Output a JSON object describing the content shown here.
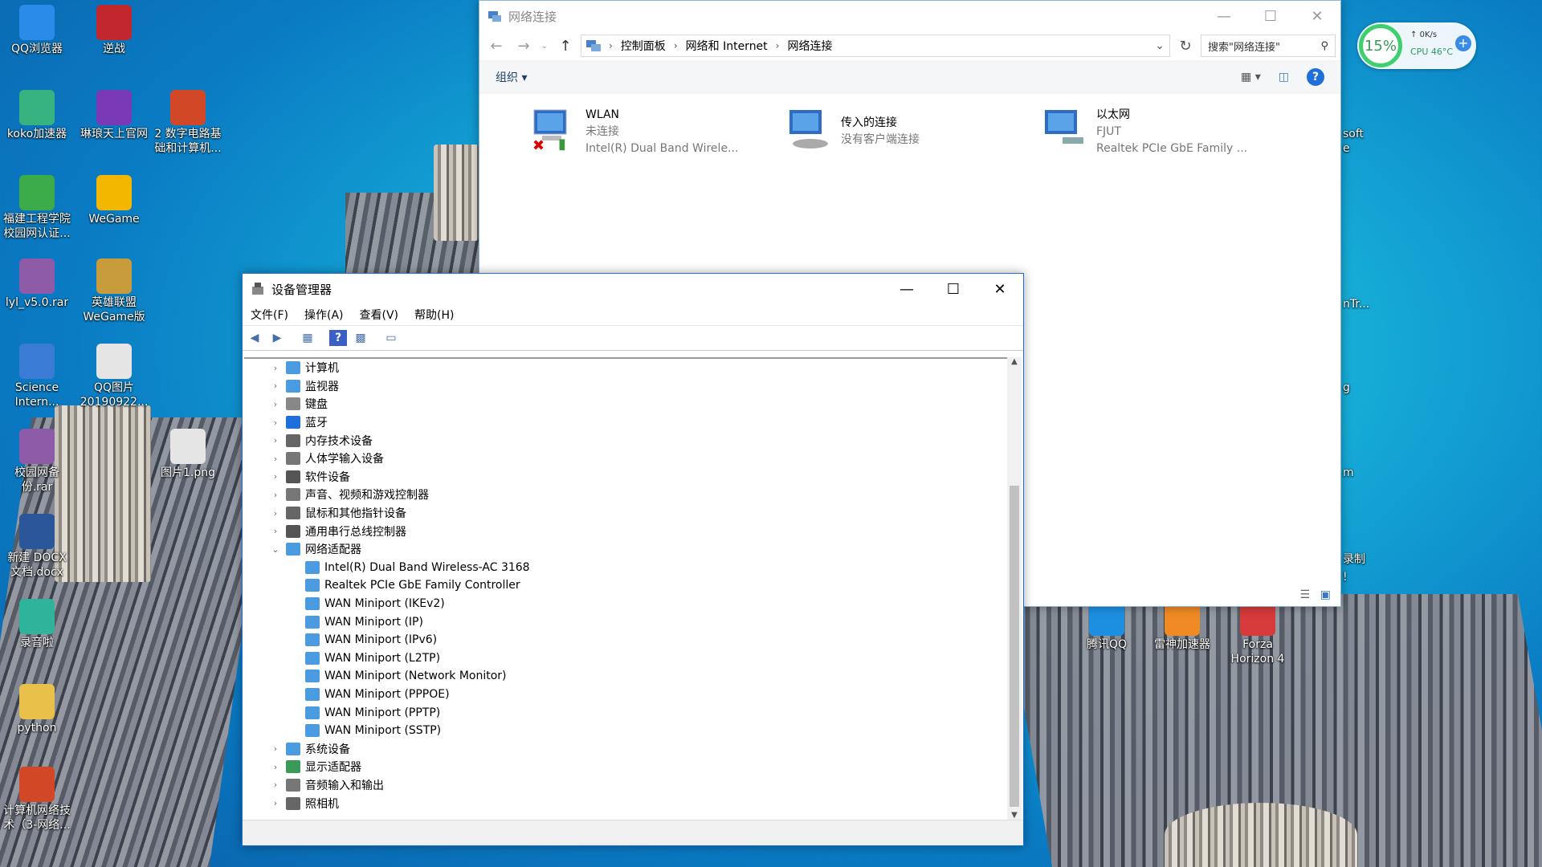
{
  "desktop": {
    "icons_left": [
      {
        "label": "QQ浏览器",
        "color": "#2a8be8"
      },
      {
        "label": "koko加速器",
        "color": "#36b37e"
      },
      {
        "label": "福建工程学院校园网认证...",
        "color": "#3cab4a"
      },
      {
        "label": "lyl_v5.0.rar",
        "color": "#8d5ba8"
      },
      {
        "label": "Science Intern...",
        "color": "#3a7bd5"
      },
      {
        "label": "校园网备份.rar",
        "color": "#8d5ba8"
      },
      {
        "label": "新建 DOCX 文档.docx",
        "color": "#2b579a"
      },
      {
        "label": "录音啦",
        "color": "#2fb39a"
      },
      {
        "label": "python",
        "color": "#e8c04a"
      },
      {
        "label": "计算机网络技术（3-网络...",
        "color": "#d24726"
      }
    ],
    "icons_col2": [
      {
        "label": "逆战",
        "color": "#c0282d"
      },
      {
        "label": "琳琅天上官网",
        "color": "#7a3ab8"
      },
      {
        "label": "WeGame",
        "color": "#f3b700"
      },
      {
        "label": "英雄联盟WeGame版",
        "color": "#c89b3c"
      },
      {
        "label": "QQ图片20190922...",
        "color": "#e5e5e5"
      }
    ],
    "icons_col3": [
      {
        "label": "2 数字电路基础和计算机...",
        "color": "#d24726"
      },
      {
        "label": "图片1.png",
        "color": "#e5e5e5"
      }
    ],
    "icons_bottom": [
      {
        "label": "腾讯QQ",
        "color": "#1d8fe1"
      },
      {
        "label": "雷神加速器",
        "color": "#f08a24"
      },
      {
        "label": "Forza Horizon 4",
        "color": "#d63a3a"
      }
    ],
    "right_partial": [
      "soft",
      "e",
      "nTr...",
      "g",
      "m",
      "录制",
      "!"
    ]
  },
  "widget": {
    "percent": "15%",
    "speed": "0K/s",
    "cpu": "CPU 46°C",
    "plus": "+"
  },
  "network_window": {
    "title": "网络连接",
    "breadcrumb": [
      "控制面板",
      "网络和 Internet",
      "网络连接"
    ],
    "search_placeholder": "搜索\"网络连接\"",
    "organize": "组织 ▾",
    "connections": [
      {
        "name": "WLAN",
        "status": "未连接",
        "device": "Intel(R) Dual Band Wirele..."
      },
      {
        "name": "传入的连接",
        "status": "没有客户端连接",
        "device": ""
      },
      {
        "name": "以太网",
        "status": "FJUT",
        "device": "Realtek PCIe GbE Family ..."
      }
    ]
  },
  "device_manager": {
    "title": "设备管理器",
    "menu": [
      "文件(F)",
      "操作(A)",
      "查看(V)",
      "帮助(H)"
    ],
    "tree": [
      {
        "label": "计算机",
        "color": "#4a9be0",
        "expanded": false
      },
      {
        "label": "监视器",
        "color": "#4a9be0",
        "expanded": false
      },
      {
        "label": "键盘",
        "color": "#888888",
        "expanded": false
      },
      {
        "label": "蓝牙",
        "color": "#1e6fd9",
        "expanded": false
      },
      {
        "label": "内存技术设备",
        "color": "#666666",
        "expanded": false
      },
      {
        "label": "人体学输入设备",
        "color": "#777777",
        "expanded": false
      },
      {
        "label": "软件设备",
        "color": "#555555",
        "expanded": false
      },
      {
        "label": "声音、视频和游戏控制器",
        "color": "#777777",
        "expanded": false
      },
      {
        "label": "鼠标和其他指针设备",
        "color": "#666666",
        "expanded": false
      },
      {
        "label": "通用串行总线控制器",
        "color": "#555555",
        "expanded": false
      },
      {
        "label": "网络适配器",
        "color": "#4a9be0",
        "expanded": true
      },
      {
        "label": "Intel(R) Dual Band Wireless-AC 3168",
        "color": "#4a9be0",
        "child": true
      },
      {
        "label": "Realtek PCIe GbE Family Controller",
        "color": "#4a9be0",
        "child": true
      },
      {
        "label": "WAN Miniport (IKEv2)",
        "color": "#4a9be0",
        "child": true
      },
      {
        "label": "WAN Miniport (IP)",
        "color": "#4a9be0",
        "child": true
      },
      {
        "label": "WAN Miniport (IPv6)",
        "color": "#4a9be0",
        "child": true
      },
      {
        "label": "WAN Miniport (L2TP)",
        "color": "#4a9be0",
        "child": true
      },
      {
        "label": "WAN Miniport (Network Monitor)",
        "color": "#4a9be0",
        "child": true
      },
      {
        "label": "WAN Miniport (PPPOE)",
        "color": "#4a9be0",
        "child": true
      },
      {
        "label": "WAN Miniport (PPTP)",
        "color": "#4a9be0",
        "child": true
      },
      {
        "label": "WAN Miniport (SSTP)",
        "color": "#4a9be0",
        "child": true
      },
      {
        "label": "系统设备",
        "color": "#4a9be0",
        "expanded": false
      },
      {
        "label": "显示适配器",
        "color": "#3a9a5a",
        "expanded": false
      },
      {
        "label": "音频输入和输出",
        "color": "#777777",
        "expanded": false
      },
      {
        "label": "照相机",
        "color": "#666666",
        "expanded": false
      }
    ]
  }
}
